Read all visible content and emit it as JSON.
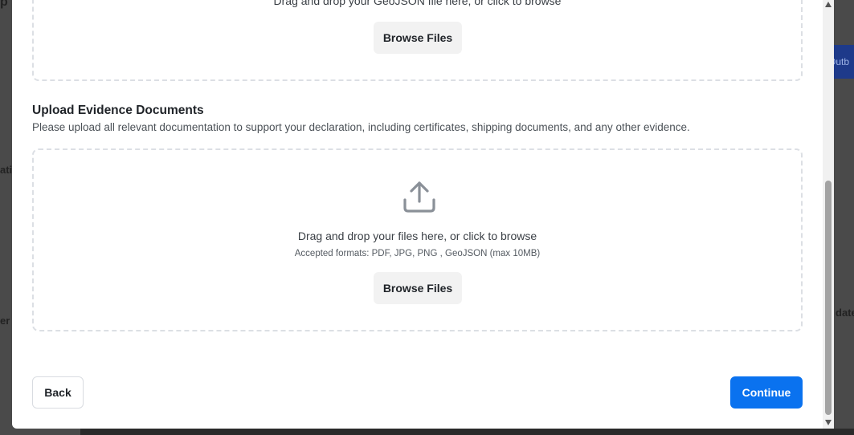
{
  "background": {
    "fragment_top": "p",
    "fragment_mid": "ati",
    "fragment_low": "er",
    "fragment_right_blue": "Outb",
    "fragment_right_low": "date"
  },
  "geojson_section": {
    "dropzone_text": "Drag and drop your GeoJSON file here, or click to browse",
    "browse_label": "Browse Files"
  },
  "evidence_section": {
    "title": "Upload Evidence Documents",
    "description": "Please upload all relevant documentation to support your declaration, including certificates, shipping documents, and any other evidence.",
    "dropzone_text": "Drag and drop your files here, or click to browse",
    "accepted_formats": "Accepted formats: PDF, JPG, PNG , GeoJSON (max 10MB)",
    "browse_label": "Browse Files",
    "icon": "upload-icon"
  },
  "footer": {
    "back_label": "Back",
    "continue_label": "Continue"
  },
  "colors": {
    "primary": "#0a72ef",
    "dashed_border": "#dcdfe4",
    "secondary_button_bg": "#f2f2f2"
  }
}
